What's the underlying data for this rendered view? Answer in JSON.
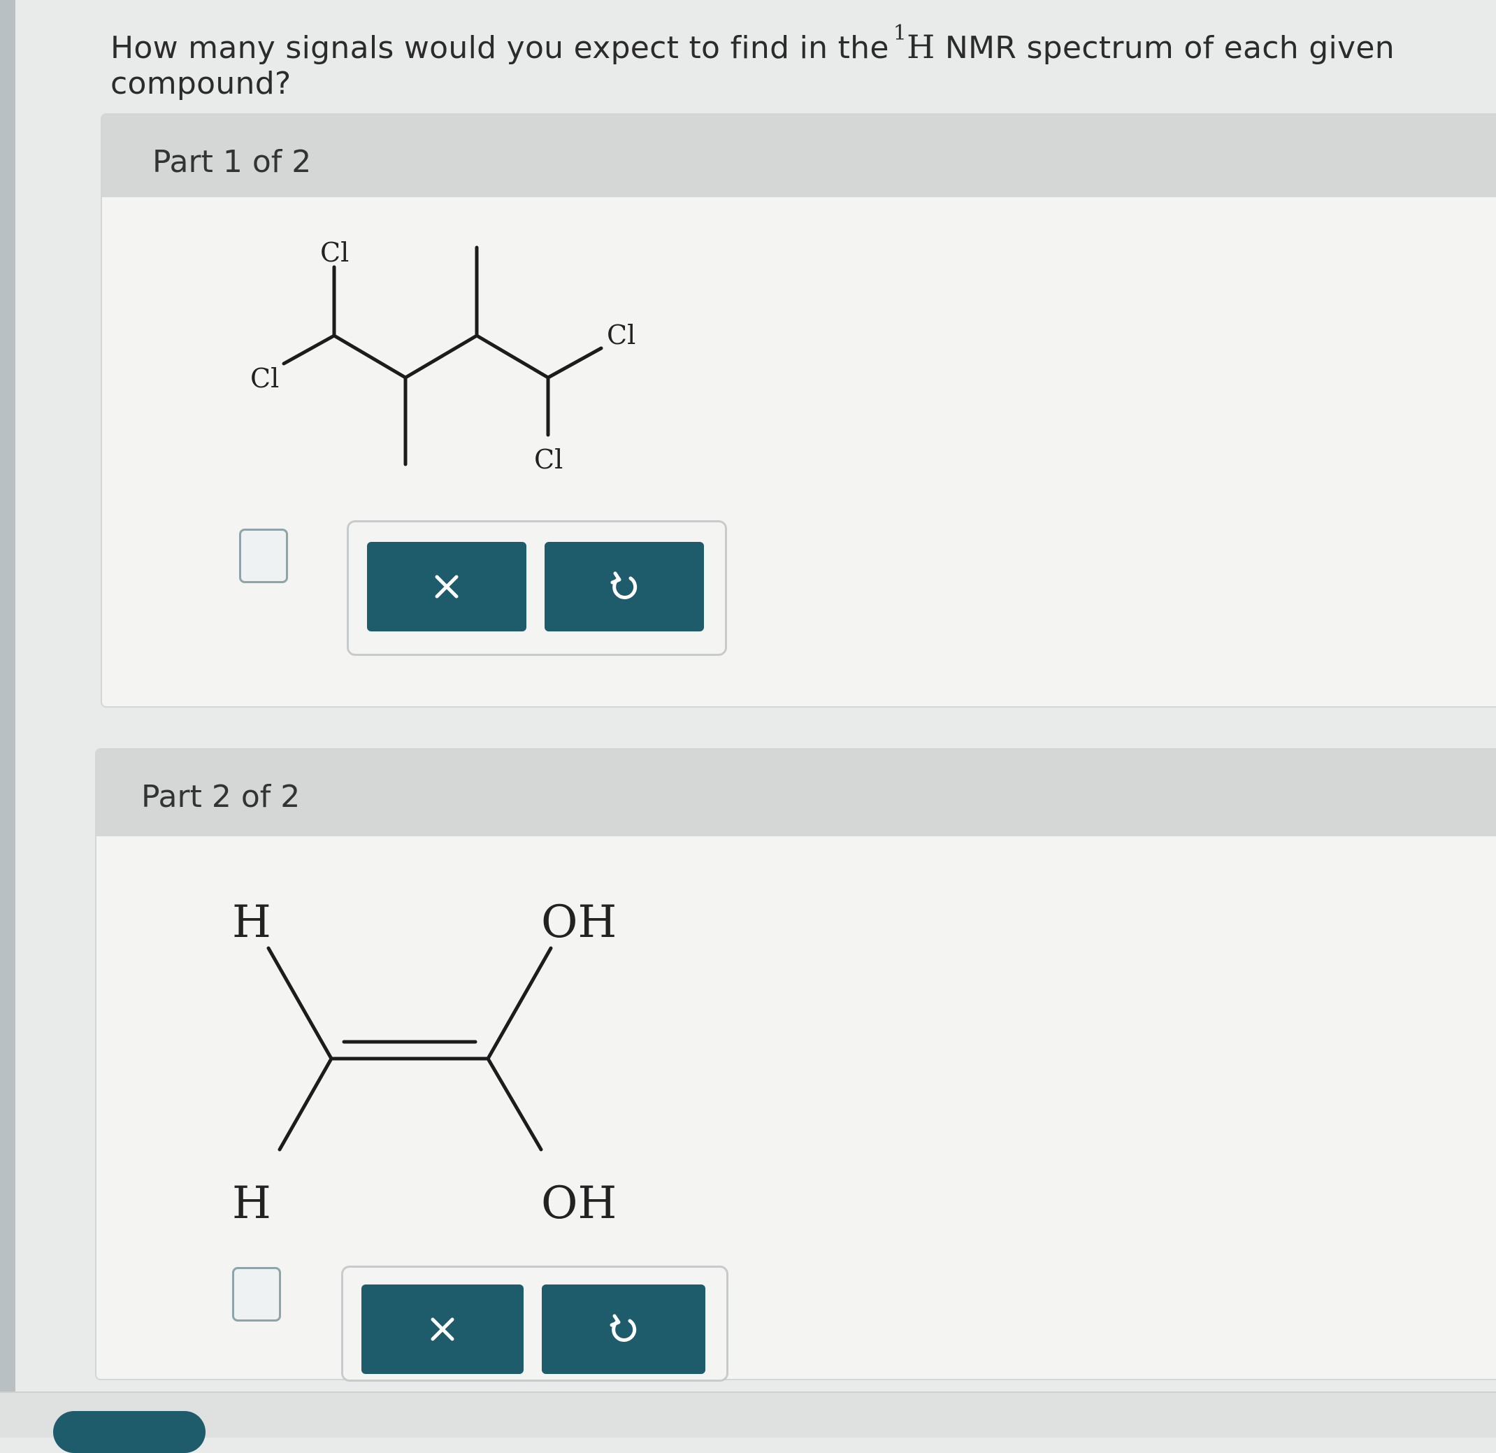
{
  "question": {
    "prefix": "How many signals would you expect to find in the",
    "sup": "1",
    "nucleus": "H",
    "suffix": "NMR spectrum of each given compound?"
  },
  "parts": [
    {
      "title": "Part 1 of 2",
      "labels": [
        "Cl",
        "Cl",
        "Cl",
        "Cl"
      ],
      "answer_value": "",
      "clear_icon": "x-icon",
      "reset_icon": "undo-icon"
    },
    {
      "title": "Part 2 of 2",
      "labels": [
        "H",
        "OH",
        "H",
        "OH"
      ],
      "answer_value": "",
      "clear_icon": "x-icon",
      "reset_icon": "undo-icon"
    }
  ],
  "colors": {
    "button": "#1e5c6c",
    "header": "#d5d7d7",
    "panel": "#f4f4f2"
  }
}
